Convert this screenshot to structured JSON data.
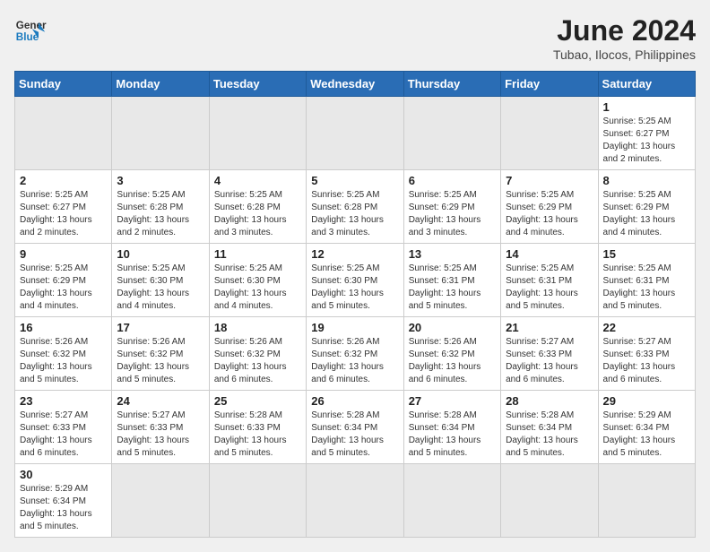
{
  "header": {
    "logo_general": "General",
    "logo_blue": "Blue",
    "title": "June 2024",
    "subtitle": "Tubao, Ilocos, Philippines"
  },
  "weekdays": [
    "Sunday",
    "Monday",
    "Tuesday",
    "Wednesday",
    "Thursday",
    "Friday",
    "Saturday"
  ],
  "weeks": [
    [
      {
        "day": "",
        "empty": true
      },
      {
        "day": "",
        "empty": true
      },
      {
        "day": "",
        "empty": true
      },
      {
        "day": "",
        "empty": true
      },
      {
        "day": "",
        "empty": true
      },
      {
        "day": "",
        "empty": true
      },
      {
        "day": "1",
        "info": "Sunrise: 5:25 AM\nSunset: 6:27 PM\nDaylight: 13 hours and 2 minutes."
      }
    ],
    [
      {
        "day": "2",
        "info": "Sunrise: 5:25 AM\nSunset: 6:27 PM\nDaylight: 13 hours and 2 minutes."
      },
      {
        "day": "3",
        "info": "Sunrise: 5:25 AM\nSunset: 6:28 PM\nDaylight: 13 hours and 2 minutes."
      },
      {
        "day": "4",
        "info": "Sunrise: 5:25 AM\nSunset: 6:28 PM\nDaylight: 13 hours and 3 minutes."
      },
      {
        "day": "5",
        "info": "Sunrise: 5:25 AM\nSunset: 6:28 PM\nDaylight: 13 hours and 3 minutes."
      },
      {
        "day": "6",
        "info": "Sunrise: 5:25 AM\nSunset: 6:29 PM\nDaylight: 13 hours and 3 minutes."
      },
      {
        "day": "7",
        "info": "Sunrise: 5:25 AM\nSunset: 6:29 PM\nDaylight: 13 hours and 4 minutes."
      },
      {
        "day": "8",
        "info": "Sunrise: 5:25 AM\nSunset: 6:29 PM\nDaylight: 13 hours and 4 minutes."
      }
    ],
    [
      {
        "day": "9",
        "info": "Sunrise: 5:25 AM\nSunset: 6:29 PM\nDaylight: 13 hours and 4 minutes."
      },
      {
        "day": "10",
        "info": "Sunrise: 5:25 AM\nSunset: 6:30 PM\nDaylight: 13 hours and 4 minutes."
      },
      {
        "day": "11",
        "info": "Sunrise: 5:25 AM\nSunset: 6:30 PM\nDaylight: 13 hours and 4 minutes."
      },
      {
        "day": "12",
        "info": "Sunrise: 5:25 AM\nSunset: 6:30 PM\nDaylight: 13 hours and 5 minutes."
      },
      {
        "day": "13",
        "info": "Sunrise: 5:25 AM\nSunset: 6:31 PM\nDaylight: 13 hours and 5 minutes."
      },
      {
        "day": "14",
        "info": "Sunrise: 5:25 AM\nSunset: 6:31 PM\nDaylight: 13 hours and 5 minutes."
      },
      {
        "day": "15",
        "info": "Sunrise: 5:25 AM\nSunset: 6:31 PM\nDaylight: 13 hours and 5 minutes."
      }
    ],
    [
      {
        "day": "16",
        "info": "Sunrise: 5:26 AM\nSunset: 6:32 PM\nDaylight: 13 hours and 5 minutes."
      },
      {
        "day": "17",
        "info": "Sunrise: 5:26 AM\nSunset: 6:32 PM\nDaylight: 13 hours and 5 minutes."
      },
      {
        "day": "18",
        "info": "Sunrise: 5:26 AM\nSunset: 6:32 PM\nDaylight: 13 hours and 6 minutes."
      },
      {
        "day": "19",
        "info": "Sunrise: 5:26 AM\nSunset: 6:32 PM\nDaylight: 13 hours and 6 minutes."
      },
      {
        "day": "20",
        "info": "Sunrise: 5:26 AM\nSunset: 6:32 PM\nDaylight: 13 hours and 6 minutes."
      },
      {
        "day": "21",
        "info": "Sunrise: 5:27 AM\nSunset: 6:33 PM\nDaylight: 13 hours and 6 minutes."
      },
      {
        "day": "22",
        "info": "Sunrise: 5:27 AM\nSunset: 6:33 PM\nDaylight: 13 hours and 6 minutes."
      }
    ],
    [
      {
        "day": "23",
        "info": "Sunrise: 5:27 AM\nSunset: 6:33 PM\nDaylight: 13 hours and 6 minutes."
      },
      {
        "day": "24",
        "info": "Sunrise: 5:27 AM\nSunset: 6:33 PM\nDaylight: 13 hours and 5 minutes."
      },
      {
        "day": "25",
        "info": "Sunrise: 5:28 AM\nSunset: 6:33 PM\nDaylight: 13 hours and 5 minutes."
      },
      {
        "day": "26",
        "info": "Sunrise: 5:28 AM\nSunset: 6:34 PM\nDaylight: 13 hours and 5 minutes."
      },
      {
        "day": "27",
        "info": "Sunrise: 5:28 AM\nSunset: 6:34 PM\nDaylight: 13 hours and 5 minutes."
      },
      {
        "day": "28",
        "info": "Sunrise: 5:28 AM\nSunset: 6:34 PM\nDaylight: 13 hours and 5 minutes."
      },
      {
        "day": "29",
        "info": "Sunrise: 5:29 AM\nSunset: 6:34 PM\nDaylight: 13 hours and 5 minutes."
      }
    ],
    [
      {
        "day": "30",
        "info": "Sunrise: 5:29 AM\nSunset: 6:34 PM\nDaylight: 13 hours and 5 minutes."
      },
      {
        "day": "",
        "empty": true
      },
      {
        "day": "",
        "empty": true
      },
      {
        "day": "",
        "empty": true
      },
      {
        "day": "",
        "empty": true
      },
      {
        "day": "",
        "empty": true
      },
      {
        "day": "",
        "empty": true
      }
    ]
  ],
  "colors": {
    "header_bg": "#2a6db5",
    "accent": "#1a7abf"
  }
}
